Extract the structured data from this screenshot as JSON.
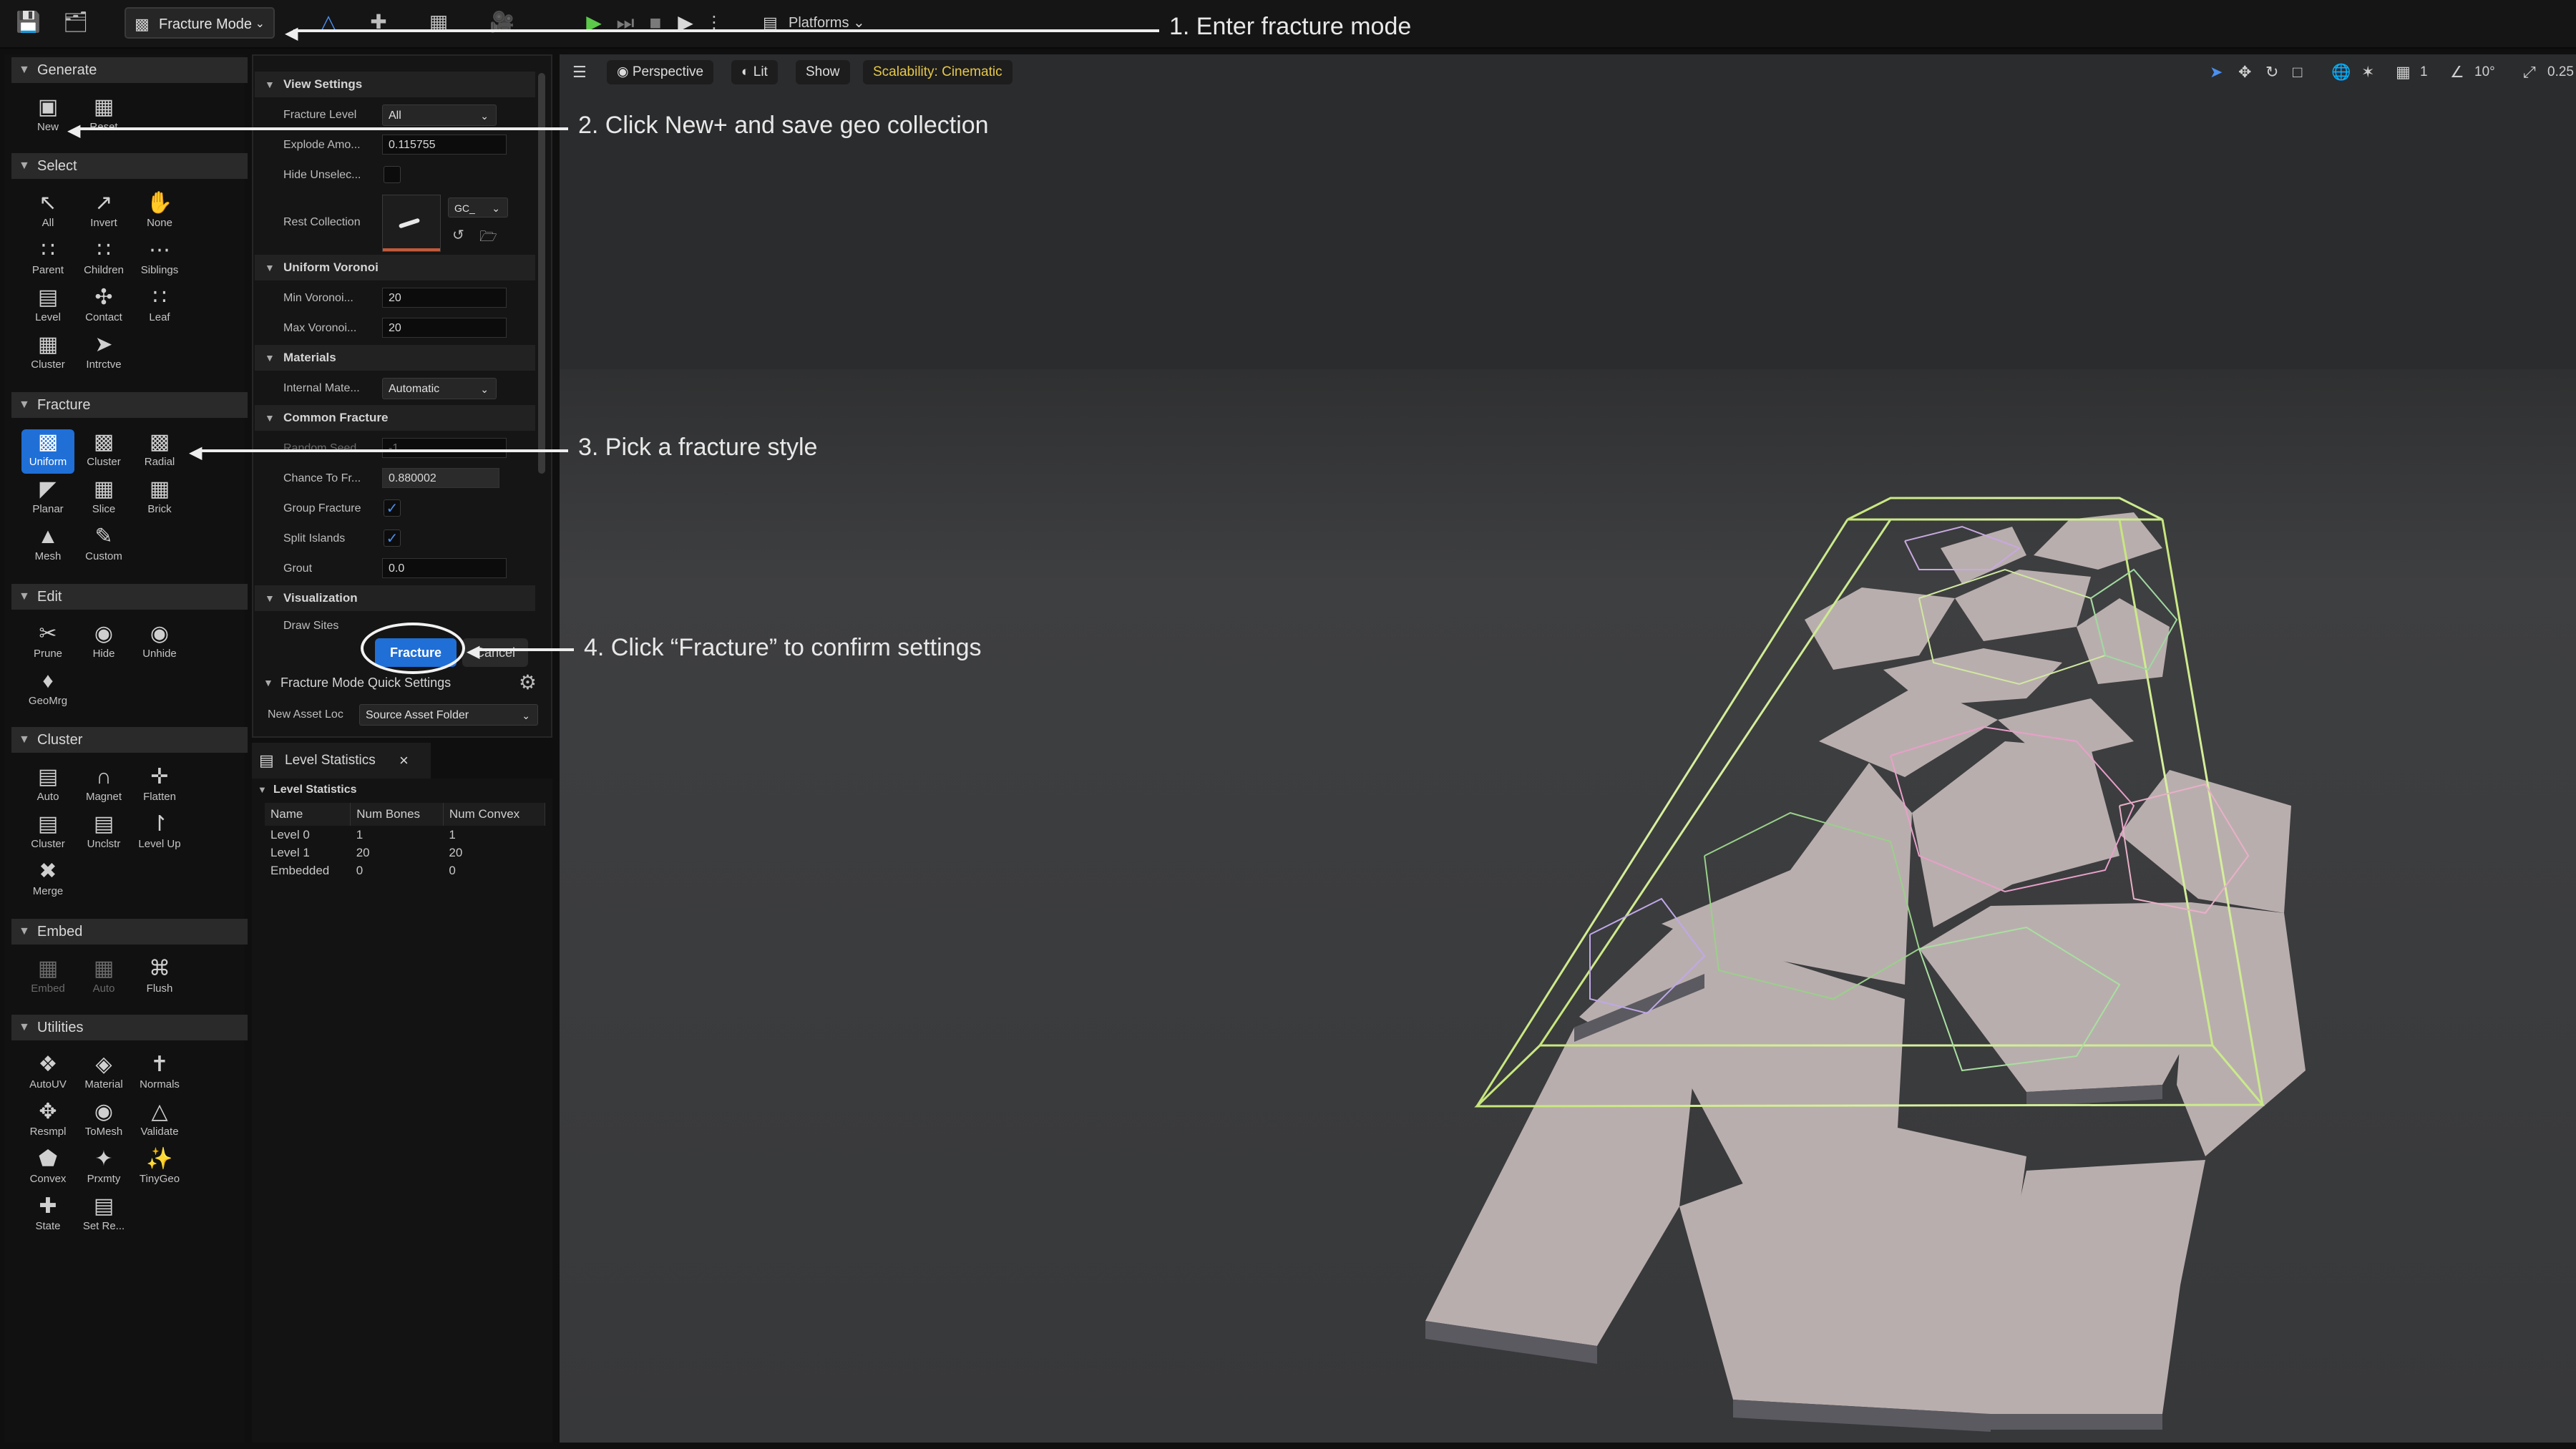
{
  "toolbar": {
    "mode_label": "Fracture Mode",
    "platforms_label": "Platforms"
  },
  "palette": {
    "generate": {
      "title": "Generate",
      "tools": [
        {
          "label": "New",
          "icon": "new-plus-icon"
        },
        {
          "label": "Reset",
          "icon": "reset-icon"
        }
      ]
    },
    "select": {
      "title": "Select",
      "tools": [
        {
          "label": "All"
        },
        {
          "label": "Invert"
        },
        {
          "label": "None"
        },
        {
          "label": "Parent"
        },
        {
          "label": "Children"
        },
        {
          "label": "Siblings"
        },
        {
          "label": "Level"
        },
        {
          "label": "Contact"
        },
        {
          "label": "Leaf"
        },
        {
          "label": "Cluster"
        },
        {
          "label": "Intrctve"
        }
      ]
    },
    "fracture": {
      "title": "Fracture",
      "tools": [
        {
          "label": "Uniform",
          "active": true
        },
        {
          "label": "Cluster"
        },
        {
          "label": "Radial"
        },
        {
          "label": "Planar"
        },
        {
          "label": "Slice"
        },
        {
          "label": "Brick"
        },
        {
          "label": "Mesh"
        },
        {
          "label": "Custom"
        }
      ]
    },
    "edit": {
      "title": "Edit",
      "tools": [
        {
          "label": "Prune"
        },
        {
          "label": "Hide"
        },
        {
          "label": "Unhide"
        },
        {
          "label": "GeoMrg"
        }
      ]
    },
    "cluster": {
      "title": "Cluster",
      "tools": [
        {
          "label": "Auto"
        },
        {
          "label": "Magnet"
        },
        {
          "label": "Flatten"
        },
        {
          "label": "Cluster"
        },
        {
          "label": "Unclstr"
        },
        {
          "label": "Level Up"
        },
        {
          "label": "Merge"
        }
      ]
    },
    "embed": {
      "title": "Embed",
      "tools": [
        {
          "label": "Embed",
          "dim": true
        },
        {
          "label": "Auto",
          "dim": true
        },
        {
          "label": "Flush"
        }
      ]
    },
    "utilities": {
      "title": "Utilities",
      "tools": [
        {
          "label": "AutoUV"
        },
        {
          "label": "Material"
        },
        {
          "label": "Normals"
        },
        {
          "label": "Resmpl"
        },
        {
          "label": "ToMesh"
        },
        {
          "label": "Validate"
        },
        {
          "label": "Convex"
        },
        {
          "label": "Prxmty"
        },
        {
          "label": "TinyGeo"
        },
        {
          "label": "State"
        },
        {
          "label": "Set Re..."
        }
      ]
    }
  },
  "details": {
    "view_settings": {
      "title": "View Settings",
      "fracture_level_label": "Fracture Level",
      "fracture_level_value": "All",
      "explode_label": "Explode Amo...",
      "explode_value": "0.115755",
      "hide_unselected_label": "Hide Unselec...",
      "rest_collection_label": "Rest Collection",
      "rest_collection_combo": "GC_"
    },
    "uniform_voronoi": {
      "title": "Uniform Voronoi",
      "min_label": "Min Voronoi...",
      "min_value": "20",
      "max_label": "Max Voronoi...",
      "max_value": "20"
    },
    "materials": {
      "title": "Materials",
      "internal_label": "Internal Mate...",
      "internal_value": "Automatic"
    },
    "common_fracture": {
      "title": "Common Fracture",
      "random_seed_label": "Random Seed",
      "random_seed_value": "-1",
      "chance_label": "Chance To Fr...",
      "chance_value": "0.880002",
      "group_label": "Group Fracture",
      "split_label": "Split Islands",
      "grout_label": "Grout",
      "grout_value": "0.0"
    },
    "visualization": {
      "title": "Visualization",
      "draw_sites_label": "Draw Sites"
    },
    "fracture_button": "Fracture",
    "cancel_button": "Cancel",
    "quick_settings_title": "Fracture Mode Quick Settings",
    "new_asset_label": "New Asset Loc",
    "new_asset_value": "Source Asset Folder"
  },
  "stats": {
    "tab_label": "Level Statistics",
    "category": "Level Statistics",
    "columns": [
      "Name",
      "Num Bones",
      "Num Convex"
    ],
    "rows": [
      [
        "Level 0",
        "1",
        "1"
      ],
      [
        "Level 1",
        "20",
        "20"
      ],
      [
        "Embedded",
        "0",
        "0"
      ]
    ]
  },
  "viewport": {
    "perspective": "Perspective",
    "lit": "Lit",
    "show": "Show",
    "scalability": "Scalability: Cinematic",
    "grid_value": "1",
    "angle_value": "10°",
    "scale_value": "0.25"
  },
  "callouts": {
    "step1": "1. Enter fracture mode",
    "step2": "2. Click New+ and save geo collection",
    "step3": "3. Pick a fracture style",
    "step4": "4. Click “Fracture” to confirm settings"
  },
  "colors": {
    "accent": "#1f6fd6",
    "play_green": "#5cc94a",
    "scalability_yellow": "#e6c84a",
    "slab": "#b7adad"
  }
}
